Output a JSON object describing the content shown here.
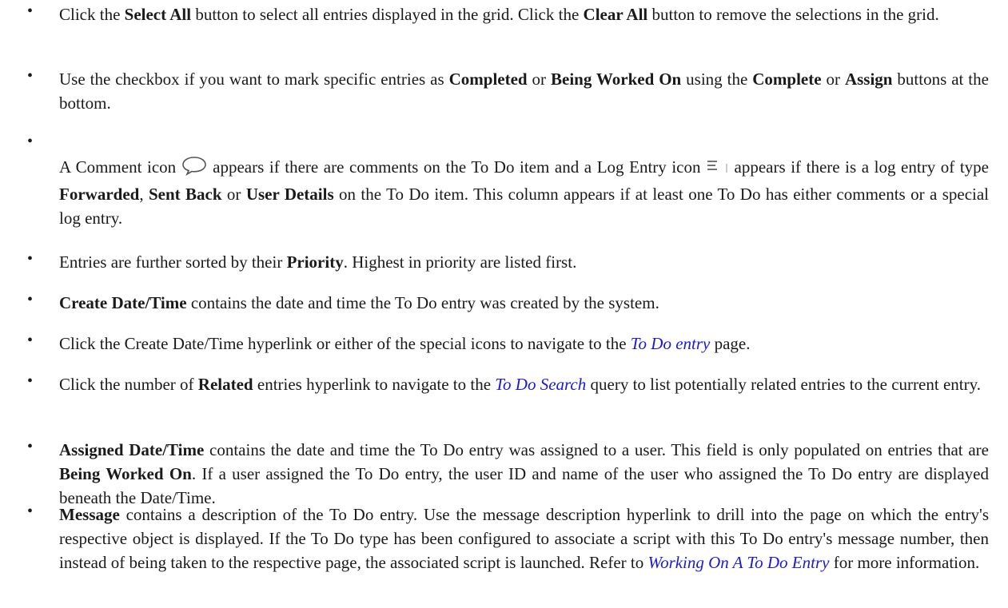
{
  "bullets": [
    {
      "id": "select",
      "html": "Click the <b>Select All</b> button to select all entries displayed in the grid. Click the <b>Clear All</b> button to remove the selections in the grid."
    },
    {
      "id": "checkbox",
      "html": "Use the checkbox if you want to mark specific entries as <b>Completed</b> or <b>Being Worked On</b> using the <b>Complete</b> or <b>Assign</b> buttons at the bottom."
    },
    {
      "id": "icons",
      "parts": {
        "p1": "A Comment icon",
        "p2": "appears if there are comments on the To Do item and a Log Entry icon",
        "p3": "appears if there is a log entry of type ",
        "b1": "Forwarded",
        "s1": ", ",
        "b2": "Sent Back",
        "s2": " or ",
        "b3": "User Details",
        "p4": " on the To Do item. This column appears if at least one To Do has either comments or a special log entry."
      },
      "icons": {
        "comment": "comment-icon",
        "log": "log-entry-icon"
      }
    },
    {
      "id": "priority",
      "html": "Entries are further sorted by their <b>Priority</b>. Highest in priority are listed first."
    },
    {
      "id": "create",
      "html": "<b>Create Date/Time</b> contains the date and time the To Do entry was created by the system."
    },
    {
      "id": "navigate",
      "html": "Click the Create Date/Time hyperlink or either of the special icons to navigate to the <a class=\"link\" data-name=\"link-to-do-entry\">To Do entry</a> page."
    },
    {
      "id": "related",
      "html": "Click the number of <b>Related</b> entries hyperlink to navigate to the <a class=\"link\" data-name=\"link-to-do-search\">To Do Search</a> query to list potentially related entries to the current entry."
    },
    {
      "id": "assigned",
      "html": "<b>Assigned Date/Time</b> contains the date and time the To Do entry was assigned to a user. This field is only populated on entries that are <b>Being Worked On</b>. If a user assigned the To Do entry, the user ID and name of the user who assigned the To Do entry are displayed beneath the Date/Time."
    },
    {
      "id": "message",
      "html": "<b>Message</b> contains a description of the To Do entry. Use the message description hyperlink to drill into the page on which the entry's respective object is displayed. If the To Do type has been configured to associate a script with this To Do entry's message number, then instead of being taken to the respective page, the associated script is launched. Refer to <a class=\"link\" data-name=\"link-working-on-entry\">Working On A To Do Entry</a> for more information."
    }
  ],
  "bullet_char": "•"
}
